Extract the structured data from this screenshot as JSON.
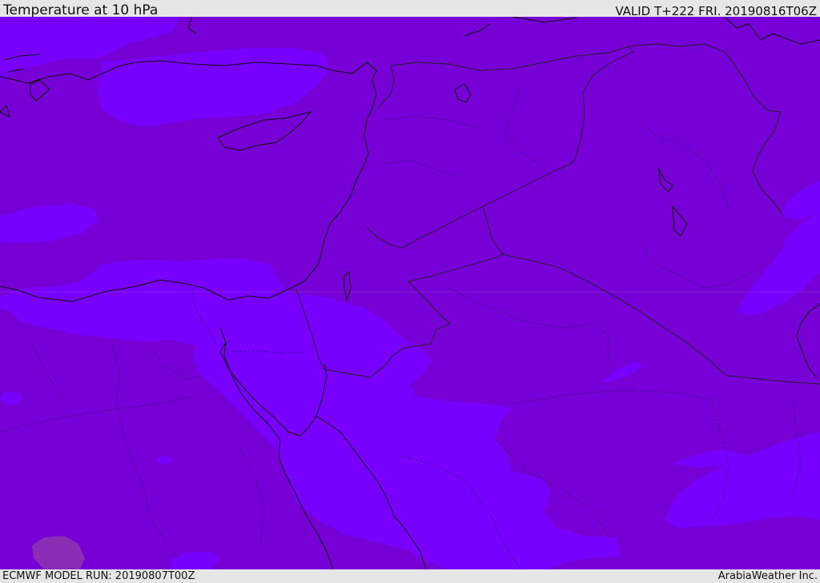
{
  "header": {
    "title": "Temperature at 10 hPa",
    "valid_time": "VALID T+222 FRI. 20190816T06Z"
  },
  "footer": {
    "model_run": "ECMWF MODEL RUN: 20190807T00Z",
    "provider": "ArabiaWeather Inc."
  },
  "map": {
    "field": "Temperature",
    "pressure_level": "10 hPa",
    "colors": {
      "base_fill": "#7700d6",
      "warmer_patch_fill": "#7800ff",
      "low_patch_fill": "#8b2db4",
      "coastline": "#111111",
      "border": "#222222"
    }
  }
}
